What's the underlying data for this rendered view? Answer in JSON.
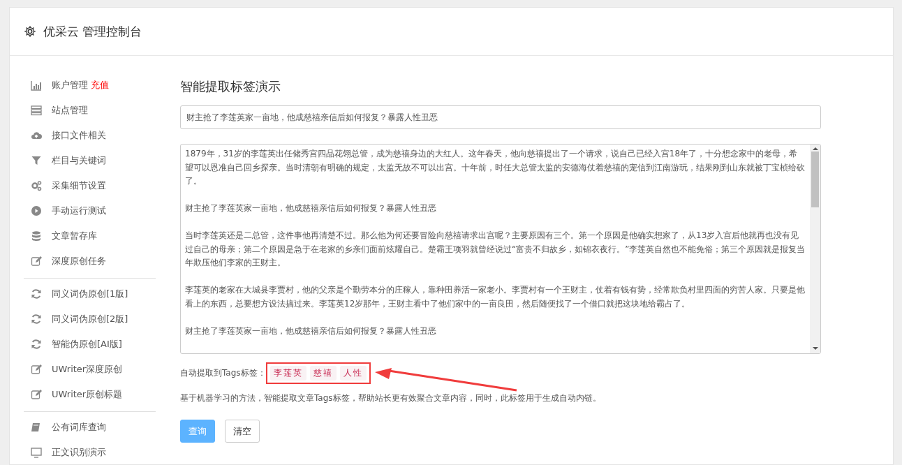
{
  "header": {
    "title": "优采云 管理控制台"
  },
  "sidebar": {
    "groups": [
      {
        "items": [
          {
            "kind": "bar-chart",
            "label": "账户管理",
            "badge": "充值",
            "selected": false
          },
          {
            "kind": "server",
            "label": "站点管理",
            "selected": false
          },
          {
            "kind": "cloud-upload",
            "label": "接口文件相关",
            "selected": false
          },
          {
            "kind": "filter",
            "label": "栏目与关键词",
            "selected": false
          },
          {
            "kind": "gears",
            "label": "采集细节设置",
            "selected": false
          },
          {
            "kind": "play",
            "label": "手动运行测试",
            "selected": false
          },
          {
            "kind": "database",
            "label": "文章暂存库",
            "selected": false
          },
          {
            "kind": "edit",
            "label": "深度原创任务",
            "selected": false
          }
        ]
      },
      {
        "items": [
          {
            "kind": "refresh",
            "label": "同义词伪原创[1版]",
            "selected": false
          },
          {
            "kind": "refresh",
            "label": "同义词伪原创[2版]",
            "selected": false
          },
          {
            "kind": "refresh",
            "label": "智能伪原创[AI版]",
            "selected": false
          },
          {
            "kind": "edit",
            "label": "UWriter深度原创",
            "selected": false
          },
          {
            "kind": "edit",
            "label": "UWriter原创标题",
            "selected": false
          }
        ]
      },
      {
        "items": [
          {
            "kind": "book",
            "label": "公有词库查询",
            "selected": false
          },
          {
            "kind": "monitor",
            "label": "正文识别演示",
            "selected": false
          }
        ]
      }
    ]
  },
  "main": {
    "heading": "智能提取标签演示",
    "title_input": {
      "value": "财主抢了李莲英家一亩地，他成慈禧亲信后如何报复？暴露人性丑恶"
    },
    "content_paragraphs": [
      "1879年，31岁的李莲英出任储秀宫四品花翎总管，成为慈禧身边的大红人。这年春天，他向慈禧提出了一个请求，说自己已经入宫18年了，十分想念家中的老母，希望可以恩准自己回乡探亲。当时清朝有明确的规定，太监无故不可以出宫。十年前，时任大总管太监的安德海仗着慈禧的宠信到江南游玩，结果刚到山东就被丁宝桢给砍了。",
      "财主抢了李莲英家一亩地，他成慈禧亲信后如何报复？暴露人性丑恶",
      "当时李莲英还是二总管，这件事他再清楚不过。那么他为何还要冒险向慈禧请求出宫呢？主要原因有三个。第一个原因是他确实想家了，从13岁入宫后他就再也没有见过自己的母亲；第二个原因是急于在老家的乡亲们面前炫耀自己。楚霸王项羽就曾经说过“富贵不归故乡，如锦衣夜行。”李莲英自然也不能免俗；第三个原因就是报复当年欺压他们李家的王财主。",
      "李莲英的老家在大城县李贾村，他的父亲是个勤劳本分的庄稼人，靠种田养活一家老小。李贾村有一个王财主，仗着有钱有势，经常欺负村里四面的穷苦人家。只要是他看上的东西，总要想方设法搞过来。李莲英12岁那年，王财主看中了他们家中的一亩良田，然后随便找了一个借口就把这块地给霸占了。",
      "财主抢了李莲英家一亩地，他成慈禧亲信后如何报复？暴露人性丑恶"
    ],
    "tags_label": "自动提取到Tags标签：",
    "tags": [
      "李莲英",
      "慈禧",
      "人性"
    ],
    "description": "基于机器学习的方法，智能提取文章Tags标签，帮助站长更有效聚合文章内容，同时，此标签用于生成自动内链。",
    "buttons": [
      {
        "label": "查询",
        "kind": "primary"
      },
      {
        "label": "清空",
        "kind": "default"
      }
    ]
  }
}
